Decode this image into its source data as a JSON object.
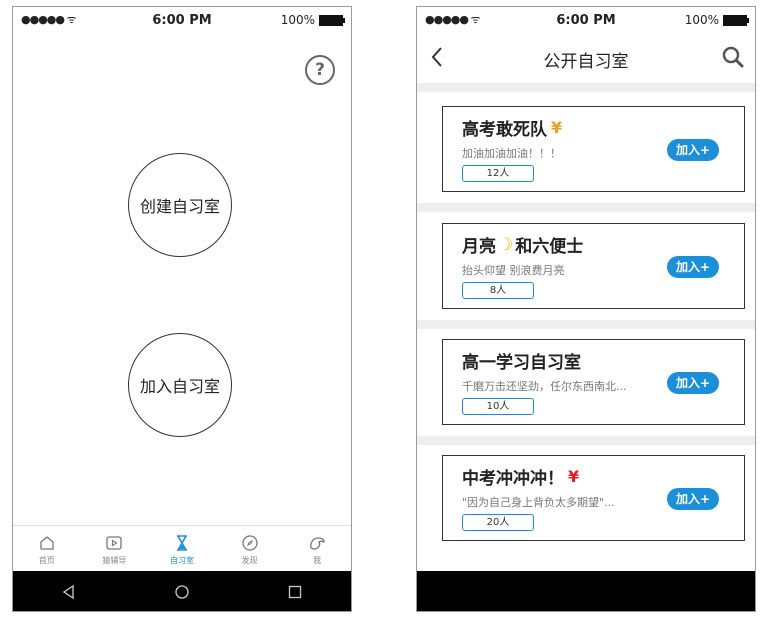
{
  "status_bar": {
    "signal": "●●●●● ",
    "time": "6:00 PM",
    "battery_text": "100%"
  },
  "left_screen": {
    "create_room_label": "创建自习室",
    "join_room_label": "加入自习室",
    "help_icon_text": "?",
    "tabs": [
      {
        "label": "首页",
        "icon": "home-icon"
      },
      {
        "label": "猿辅导",
        "icon": "play-icon"
      },
      {
        "label": "自习室",
        "icon": "hourglass-icon",
        "active": true
      },
      {
        "label": "发现",
        "icon": "compass-icon"
      },
      {
        "label": "我",
        "icon": "profile-icon"
      }
    ],
    "active_color": "#1b8fd8"
  },
  "right_screen": {
    "title": "公开自习室",
    "join_label": "加入+",
    "rooms": [
      {
        "name": "高考敢死队",
        "badge": "¥",
        "badge_color": "#f0a020",
        "description": "加油加油加油！！！",
        "members": "12人"
      },
      {
        "name": "月亮",
        "moon": "☽",
        "name_suffix": "和六便士",
        "description": "抬头仰望 别浪费月亮",
        "members": "8人"
      },
      {
        "name": "高一学习自习室",
        "description": "千磨万击还坚劲，任尔东西南北...",
        "members": "10人"
      },
      {
        "name": "中考冲冲冲！",
        "badge": "¥",
        "badge_color": "#e02020",
        "description": "\"因为自己身上背负太多期望\"...",
        "members": "20人"
      }
    ],
    "accent_color": "#1b8fd8"
  }
}
